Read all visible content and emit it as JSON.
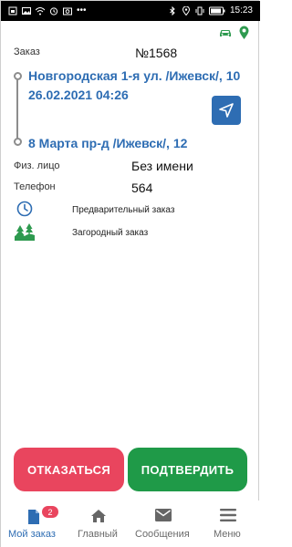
{
  "status_bar": {
    "time": "15:23",
    "icons_left": [
      "sim-icon",
      "image-icon",
      "wifi-icon",
      "alarm-icon",
      "photo-icon",
      "more-icon"
    ],
    "icons_right": [
      "bluetooth-icon",
      "location-icon",
      "vibrate-icon",
      "battery-icon"
    ]
  },
  "order": {
    "label": "Заказ",
    "number": "№1568",
    "from_address": "Новгородская 1-я ул. /Ижевск/, 10",
    "datetime": "26.02.2021 04:26",
    "to_address": "8 Марта пр-д /Ижевск/, 12",
    "person_label": "Физ. лицо",
    "person_value": "Без имени",
    "phone_label": "Телефон",
    "phone_value": "564",
    "features": [
      {
        "text": "Предварительный заказ",
        "icon": "clock-icon"
      },
      {
        "text": "Загородный заказ",
        "icon": "countryside-icon"
      }
    ]
  },
  "actions": {
    "decline": "ОТКАЗАТЬСЯ",
    "confirm": "ПОДТВЕРДИТЬ"
  },
  "tabs": [
    {
      "label": "Мой заказ",
      "icon": "document-icon",
      "badge": "2",
      "active": true
    },
    {
      "label": "Главный",
      "icon": "home-icon"
    },
    {
      "label": "Сообщения",
      "icon": "mail-icon"
    },
    {
      "label": "Меню",
      "icon": "hamburger-icon"
    }
  ],
  "colors": {
    "accent_blue": "#2e6db3",
    "decline_red": "#e9455e",
    "confirm_green": "#1f9a48",
    "indicator_green": "#2e9a4f"
  }
}
